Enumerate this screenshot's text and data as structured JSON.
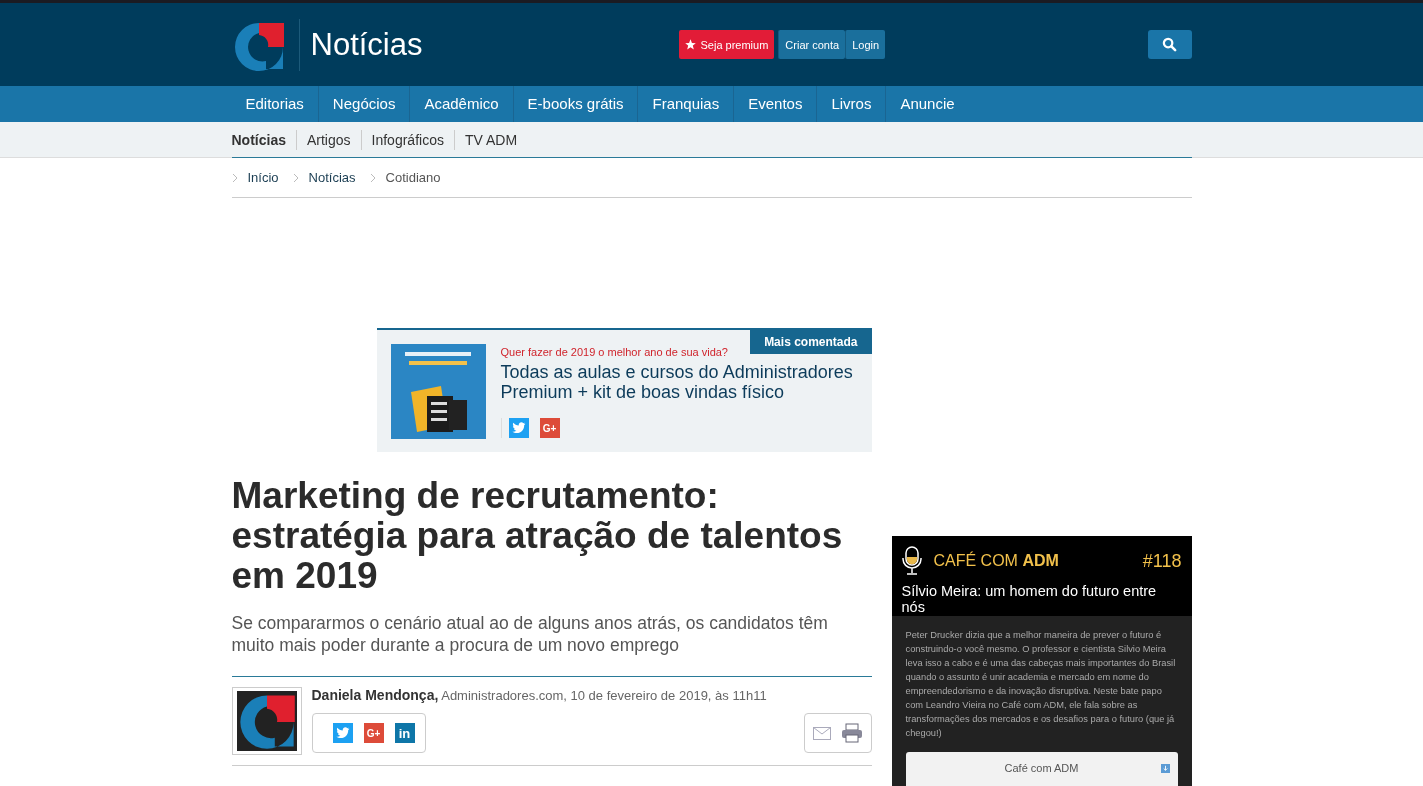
{
  "header": {
    "section_title": "Notícias",
    "buttons": [
      {
        "label": "Seja premium",
        "kind": "premium"
      },
      {
        "label": "Criar conta",
        "kind": "account"
      },
      {
        "label": "Login",
        "kind": "account"
      }
    ]
  },
  "nav": {
    "items": [
      "Editorias",
      "Negócios",
      "Acadêmico",
      "E-books grátis",
      "Franquias",
      "Eventos",
      "Livros",
      "Anuncie"
    ]
  },
  "subnav": {
    "items": [
      {
        "label": "Notícias",
        "selected": true
      },
      {
        "label": "Artigos",
        "selected": false
      },
      {
        "label": "Infográficos",
        "selected": false
      },
      {
        "label": "TV ADM",
        "selected": false
      }
    ]
  },
  "breadcrumb": [
    "Início",
    "Notícias",
    "Cotidiano"
  ],
  "promo": {
    "badge": "Mais comentada",
    "kicker": "Quer fazer de 2019 o melhor ano de sua vida?",
    "headline": "Todas as aulas e cursos do Administradores Premium + kit de boas vindas físico",
    "share": [
      {
        "kind": "twitter"
      },
      {
        "kind": "gplus",
        "label": "G+"
      }
    ]
  },
  "article": {
    "title": "Marketing de recrutamento: estratégia para atração de talentos em 2019",
    "subtitle": "Se compararmos o cenário atual ao de alguns anos atrás, os candidatos têm muito mais poder durante a procura de um novo emprego",
    "author": "Daniela Mendonça,",
    "byline": "Administradores.com, 10 de fevereiro de 2019, às 11h11",
    "share": [
      {
        "kind": "twitter"
      },
      {
        "kind": "gplus",
        "label": "G+"
      },
      {
        "kind": "linkedin",
        "label": "in"
      }
    ]
  },
  "podcast": {
    "brand_light": "CAFÉ COM",
    "brand_bold": "ADM",
    "episode": "#118",
    "title": "Sílvio Meira: um homem do futuro entre nós",
    "description": "Peter Drucker dizia que a melhor maneira de prever o futuro é construindo-o você mesmo. O professor e cientista Silvio Meira leva isso a cabo e é uma das cabeças mais importantes do Brasil quando o assunto é unir academia e mercado em nome do empreendedorismo e da inovação disruptiva. Neste bate papo com Leandro Vieira no Café com ADM, ele fala sobre as transformações dos mercados e os desafios para o futuro (que já chegou!)",
    "player_title": "Café com ADM"
  }
}
